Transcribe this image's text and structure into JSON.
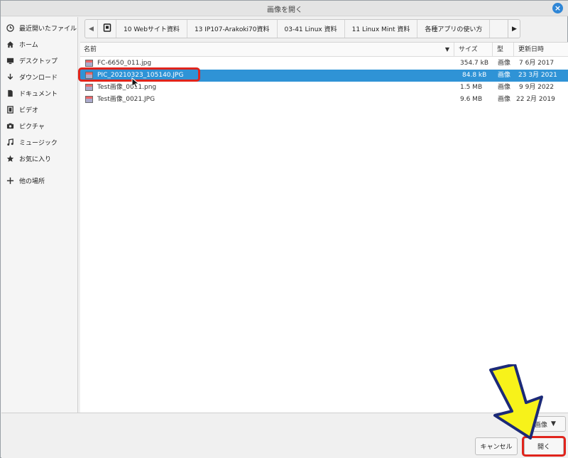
{
  "window": {
    "title": "画像を開く",
    "close_glyph": "×"
  },
  "sidebar": {
    "items": [
      {
        "label": "最近開いたファイル",
        "icon": "clock-icon"
      },
      {
        "label": "ホーム",
        "icon": "home-icon"
      },
      {
        "label": "デスクトップ",
        "icon": "desktop-icon"
      },
      {
        "label": "ダウンロード",
        "icon": "download-icon"
      },
      {
        "label": "ドキュメント",
        "icon": "document-icon"
      },
      {
        "label": "ビデオ",
        "icon": "video-icon"
      },
      {
        "label": "ピクチャ",
        "icon": "camera-icon"
      },
      {
        "label": "ミュージック",
        "icon": "music-icon"
      },
      {
        "label": "お気に入り",
        "icon": "star-icon"
      },
      {
        "label": "他の場所",
        "icon": "plus-icon"
      }
    ]
  },
  "pathbar": {
    "left_glyph": "◀",
    "right_glyph": "▶",
    "segments": [
      "10 Webサイト資料",
      "13 IP107-Arakoki70資料",
      "03-41 Linux 資料",
      "11 Linux Mint 資料",
      "各種アプリの使い方"
    ]
  },
  "columns": {
    "name": "名前",
    "size": "サイズ",
    "type": "型",
    "modified": "更新日時",
    "sort_glyph": "▼"
  },
  "files": [
    {
      "name": "FC-6650_011.jpg",
      "size": "354.7 kB",
      "type": "画像",
      "modified": "7  6月 2017",
      "selected": false
    },
    {
      "name": "PIC_20210323_105140.JPG",
      "size": "84.8 kB",
      "type": "画像",
      "modified": "23  3月 2021",
      "selected": true
    },
    {
      "name": "Test画像_0011.png",
      "size": "1.5 MB",
      "type": "画像",
      "modified": "9  9月 2022",
      "selected": false
    },
    {
      "name": "Test画像_0021.JPG",
      "size": "9.6 MB",
      "type": "画像",
      "modified": "22  2月 2019",
      "selected": false
    }
  ],
  "filter": {
    "value": "画像",
    "glyph": "▼"
  },
  "buttons": {
    "cancel": "キャンセル",
    "open": "開く"
  },
  "colors": {
    "selection": "#2f93d6",
    "highlight": "#e0241c",
    "arrow": "#f7f21a"
  }
}
